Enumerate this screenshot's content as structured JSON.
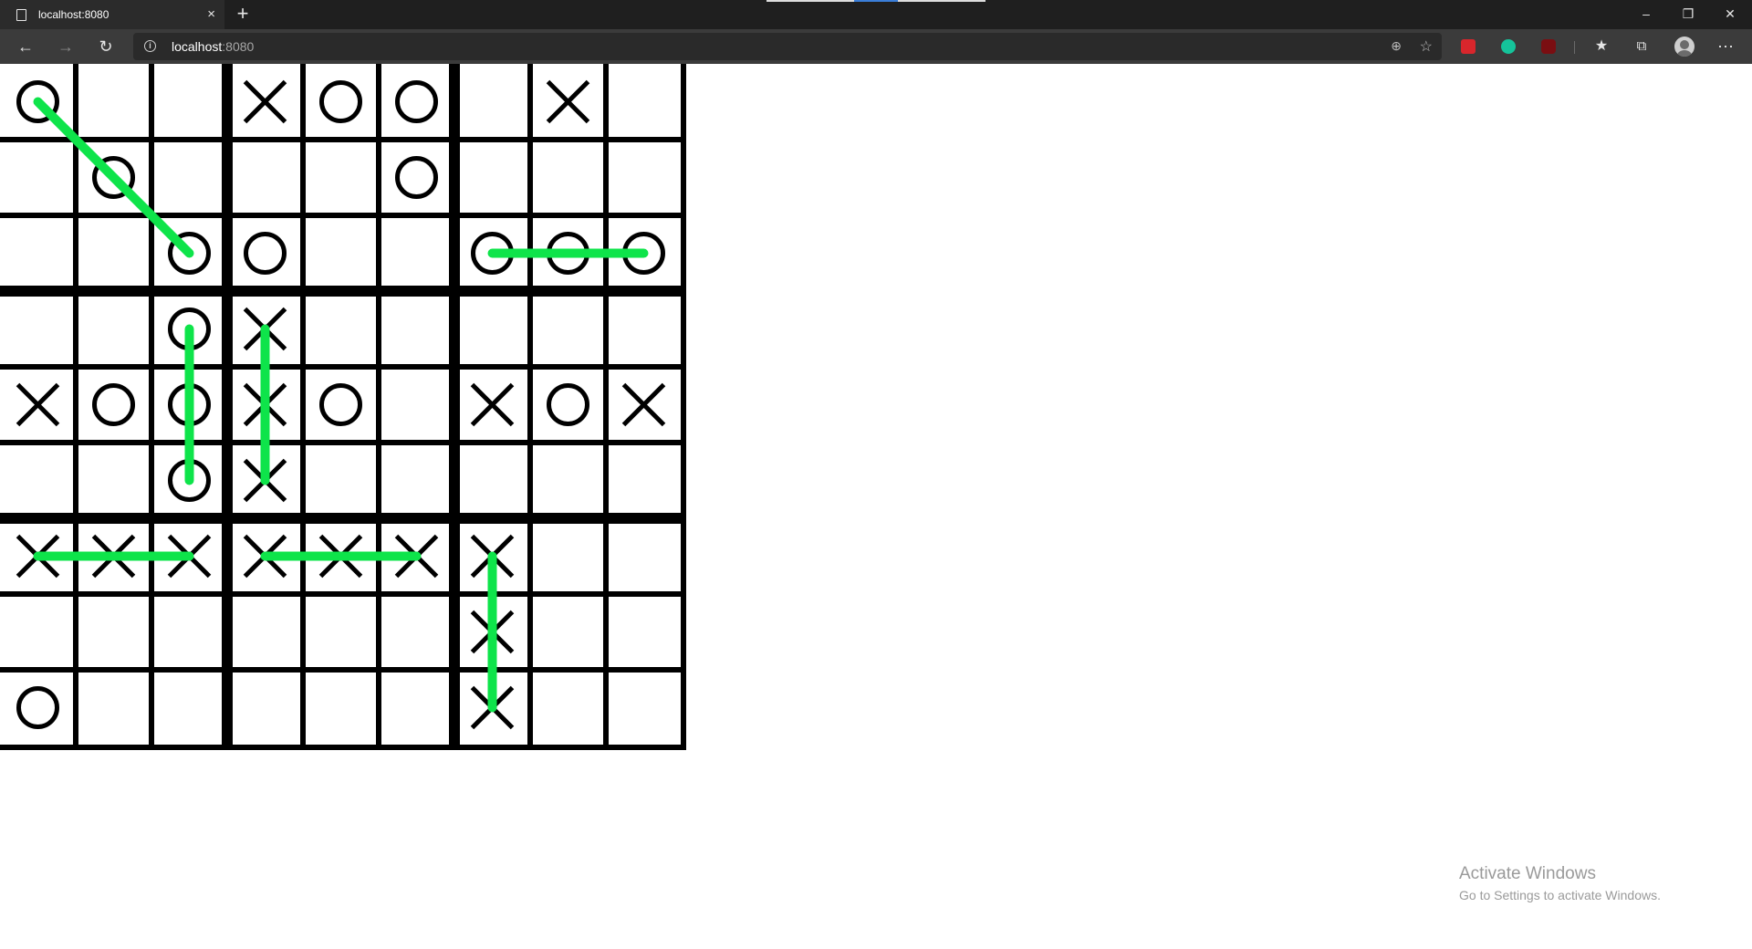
{
  "browser": {
    "tab_title": "localhost:8080",
    "tab_close": "×",
    "new_tab": "+",
    "url_host": "localhost",
    "url_port": ":8080",
    "window_controls": [
      "–",
      "❐",
      "✕"
    ]
  },
  "board": {
    "marks": [
      [
        "O",
        "",
        "",
        "X",
        "O",
        "O",
        "",
        "X",
        ""
      ],
      [
        "",
        "O",
        "",
        "",
        "",
        "O",
        "",
        "",
        ""
      ],
      [
        "",
        "",
        "O",
        "O",
        "",
        "",
        "O",
        "O",
        "O"
      ],
      [
        "",
        "",
        "O",
        "X",
        "",
        "",
        "",
        "",
        ""
      ],
      [
        "X",
        "O",
        "O",
        "X",
        "O",
        "",
        "X",
        "O",
        "X"
      ],
      [
        "",
        "",
        "O",
        "X",
        "",
        "",
        "",
        "",
        ""
      ],
      [
        "X",
        "X",
        "X",
        "X",
        "X",
        "X",
        "X",
        "",
        ""
      ],
      [
        "",
        "",
        "",
        "",
        "",
        "",
        "X",
        "",
        ""
      ],
      [
        "O",
        "",
        "",
        "",
        "",
        "",
        "X",
        "",
        ""
      ]
    ],
    "win_lines": [
      {
        "from": [
          0,
          0
        ],
        "to": [
          2,
          2
        ]
      },
      {
        "from": [
          2,
          6
        ],
        "to": [
          2,
          8
        ]
      },
      {
        "from": [
          3,
          2
        ],
        "to": [
          5,
          2
        ]
      },
      {
        "from": [
          3,
          3
        ],
        "to": [
          5,
          3
        ]
      },
      {
        "from": [
          6,
          0
        ],
        "to": [
          6,
          2
        ]
      },
      {
        "from": [
          6,
          3
        ],
        "to": [
          6,
          5
        ]
      },
      {
        "from": [
          6,
          6
        ],
        "to": [
          8,
          6
        ]
      }
    ],
    "line_color": "#0ee44a"
  },
  "watermark": {
    "title": "Activate Windows",
    "subtitle": "Go to Settings to activate Windows."
  }
}
